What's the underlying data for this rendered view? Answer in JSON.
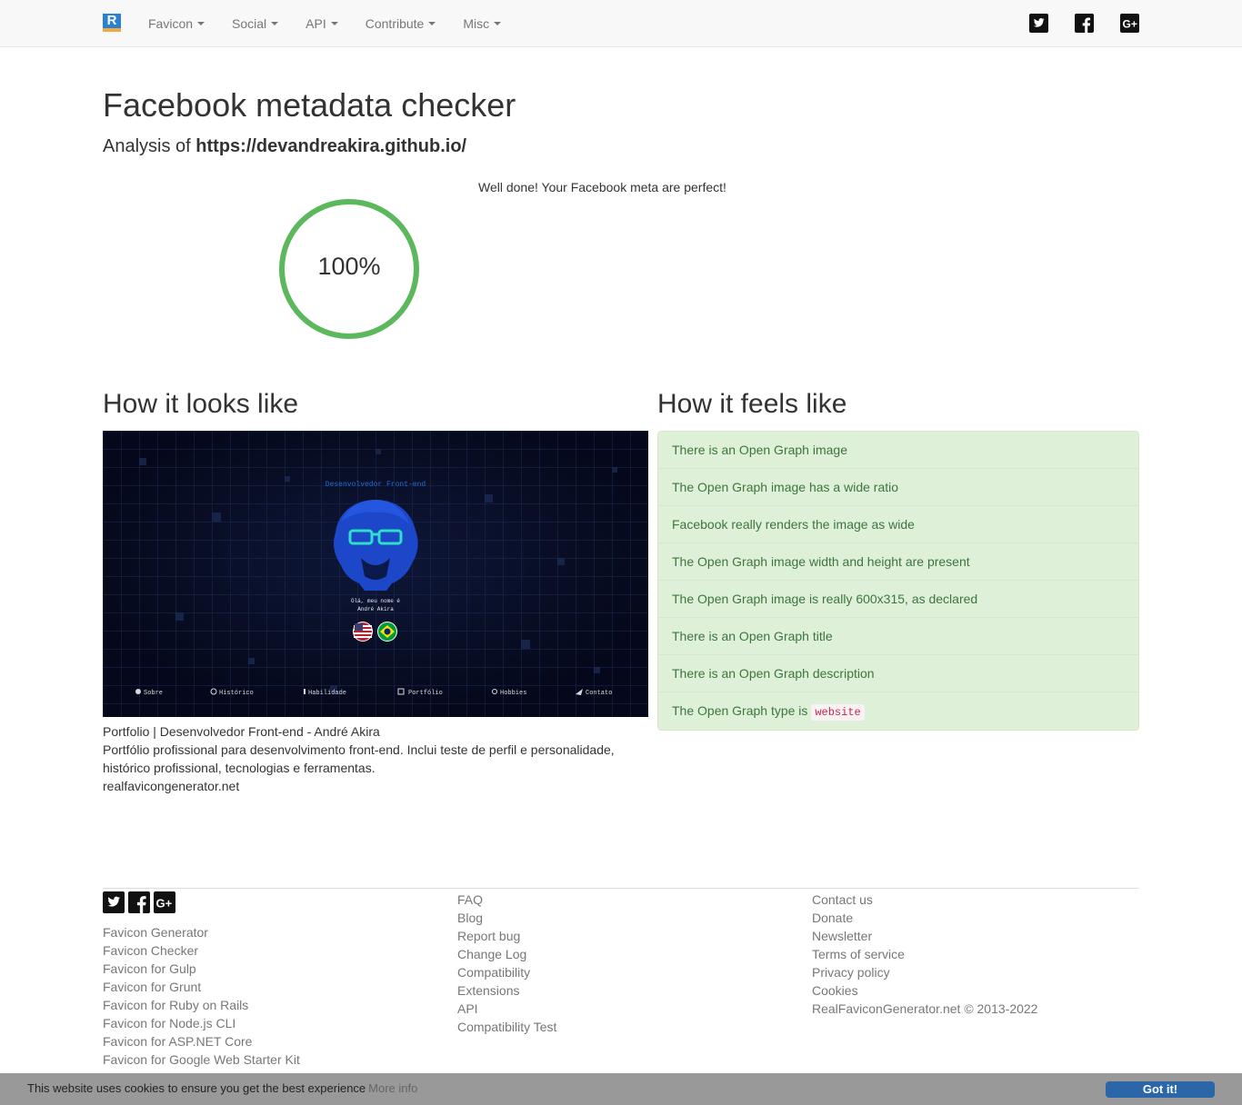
{
  "navbar": {
    "brand_letter": "R",
    "items": [
      {
        "label": "Favicon"
      },
      {
        "label": "Social"
      },
      {
        "label": "API"
      },
      {
        "label": "Contribute"
      },
      {
        "label": "Misc"
      }
    ],
    "social_icons": [
      "twitter-icon",
      "facebook-icon",
      "google-plus-icon"
    ]
  },
  "main": {
    "title": "Facebook metadata checker",
    "analysis_prefix": "Analysis of",
    "analyzed_url": "https://devandreakira.github.io/",
    "score": {
      "percent_label": "100%",
      "value": 1.0,
      "color": "#5cb85c"
    },
    "verdict": "Well done! Your Facebook meta are perfect!"
  },
  "preview": {
    "heading": "How it looks like",
    "image": {
      "subtitle": "Desenvolvedor Front-end",
      "greeting_line1": "Olá, meu nome é",
      "greeting_line2": "André Akira",
      "nav": [
        "Sobre",
        "Histórico",
        "Habilidade",
        "Portfólio",
        "Hobbies",
        "Contato"
      ]
    },
    "og_title": "Portfolio | Desenvolvedor Front-end - André Akira",
    "og_description": "Portfólio profissional para desenvolvimento front-end. Inclui teste de perfil e personalidade, histórico profissional, tecnologias e ferramentas.",
    "og_site": "realfavicongenerator.net"
  },
  "checks": {
    "heading": "How it feels like",
    "items": [
      {
        "text": "There is an Open Graph image"
      },
      {
        "text": "The Open Graph image has a wide ratio"
      },
      {
        "text": "Facebook really renders the image as wide"
      },
      {
        "text": "The Open Graph image width and height are present"
      },
      {
        "text": "The Open Graph image is really 600x315, as declared"
      },
      {
        "text": "There is an Open Graph title"
      },
      {
        "text": "There is an Open Graph description"
      },
      {
        "text": "The Open Graph type is",
        "code": "website"
      }
    ]
  },
  "footer": {
    "col1": [
      "Favicon Generator",
      "Favicon Checker",
      "Favicon for Gulp",
      "Favicon for Grunt",
      "Favicon for Ruby on Rails",
      "Favicon for Node.js CLI",
      "Favicon for ASP.NET Core",
      "Favicon for Google Web Starter Kit"
    ],
    "col2": [
      "FAQ",
      "Blog",
      "Report bug",
      "Change Log",
      "Compatibility",
      "Extensions",
      "API",
      "Compatibility Test"
    ],
    "col3": [
      "Contact us",
      "Donate",
      "Newsletter",
      "Terms of service",
      "Privacy policy",
      "Cookies"
    ],
    "copyright": "RealFaviconGenerator.net © 2013-2022"
  },
  "cookie": {
    "message": "This website uses cookies to ensure you get the best experience",
    "more_info": "More info",
    "button": "Got it!"
  }
}
